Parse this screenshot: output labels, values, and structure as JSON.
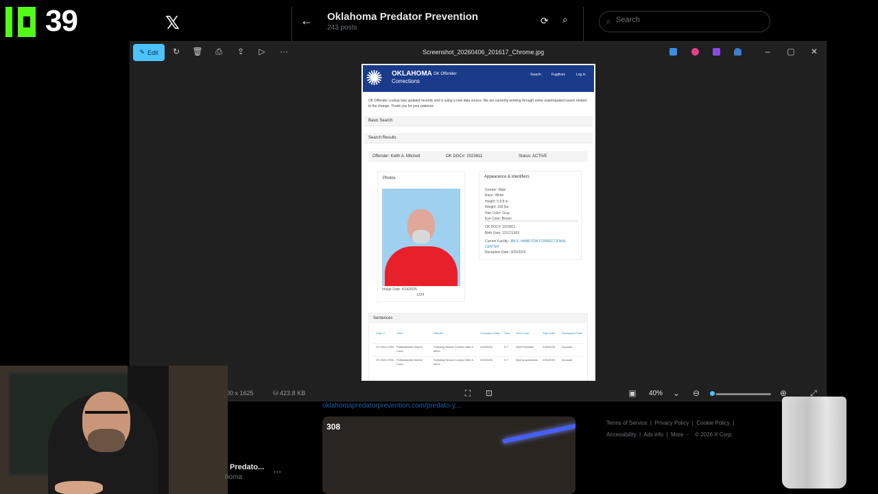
{
  "stream": {
    "viewer_count": "39"
  },
  "x_header": {
    "title": "Oklahoma Predator Prevention",
    "post_count": "243 posts"
  },
  "x_search": {
    "placeholder": "Search"
  },
  "viewer": {
    "edit_label": "Edit",
    "file_name": "Screenshot_20260406_201617_Chrome.jpg",
    "dimensions": "00 x 1625",
    "file_size": "423.8 KB",
    "zoom": "40%",
    "zoom_level": 0.05
  },
  "document": {
    "brand": "OKLAHOMA",
    "brand_sub": "Corrections",
    "nav_title": "OK Offender",
    "nav_links": [
      "Search",
      "Fugitives",
      "Log in"
    ],
    "notice": "OK Offender Lookup was updated recently and is using a new data source. We are currently working through some unanticipated issues related to the change. Thank you for your patience.",
    "basic_search": "Basic Search",
    "search_results": "Search Results",
    "offender": "Offender: Keith A. Mitchell",
    "doc_number": "OK DOC#: 2023811",
    "status": "Status: ACTIVE",
    "photos_title": "Photos",
    "image_date": "Image Date: 4/14/2025",
    "image_number": "1234",
    "ident_title": "Appearance & Identifiers",
    "ident_lines": [
      "Gender: Male",
      "Race: White",
      "Height: 5 ft 8 in",
      "Weight: 166 lbs",
      "Hair Color: Gray",
      "Eye Color: Brown"
    ],
    "ident_doc": "OK DOC#: 2023811",
    "birth_date": "Birth Date: 12/17/1953",
    "facility_label": "Current Facility:",
    "facility_name": "JIM E. HAMILTON CORRECTIONAL CENTER",
    "reception_date": "Reception Date: 3/25/2025",
    "sentences_title": "Sentences",
    "sentence_headers": [
      "Case #",
      "Court",
      "Offense",
      "Conviction Date",
      "Term",
      "Term Code",
      "Start Date",
      "Discharged Date"
    ],
    "sentence_rows": [
      [
        "CF-2024-0765",
        "Pottawatomie District Court",
        "Soliciting Sexual Conduct With A Minor",
        "2/26/2025",
        "5 Y",
        "Split Probation",
        "2/26/2025",
        "Imposed"
      ],
      [
        "CF-2024-0766",
        "Pottawatomie District Court",
        "Soliciting Sexual Conduct With A Minor",
        "2/26/2025",
        "5 Y",
        "Split Incarceration",
        "2/26/2025",
        "Imposed"
      ]
    ]
  },
  "feed": {
    "link": "oklahomapredatorprevention.com/predato-y...",
    "video_count": "308",
    "profile_name": "Predato...",
    "profile_handle": "homa"
  },
  "footer": {
    "links": [
      "Terms of Service",
      "Privacy Policy",
      "Cookie Policy",
      "Accessibility",
      "Ads info",
      "More ···",
      "© 2026 X Corp."
    ]
  }
}
